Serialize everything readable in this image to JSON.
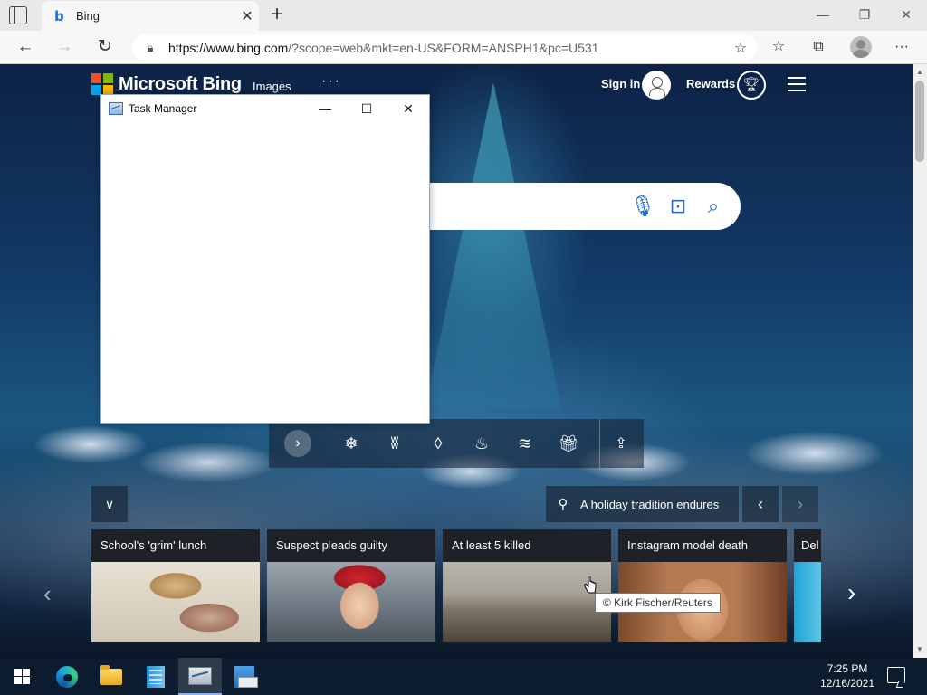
{
  "browser": {
    "tab_title": "Bing",
    "tab_favicon": "b",
    "url_host": "https://www.bing.com",
    "url_path": "/?scope=web&mkt=en-US&FORM=ANSPH1&pc=U531"
  },
  "bing": {
    "logo_text": "Microsoft Bing",
    "nav_images": "Images",
    "nav_more": "···",
    "signin": "Sign in",
    "rewards": "Rewards",
    "caption": "A holiday tradition endures",
    "image_credit": "© Kirk Fischer/Reuters",
    "news_cards": [
      {
        "title": "School's 'grim' lunch",
        "image": "pie-image"
      },
      {
        "title": "Suspect pleads guilty",
        "image": "person-image"
      },
      {
        "title": "At least 5 killed",
        "image": "storm-image"
      },
      {
        "title": "Instagram model death",
        "image": "face-image"
      },
      {
        "title": "Del",
        "image": "partial-image"
      }
    ]
  },
  "task_manager": {
    "title": "Task Manager"
  },
  "taskbar": {
    "time": "7:25 PM",
    "date": "12/16/2021"
  },
  "icons": {
    "search_bar_icons": [
      "microphone-icon",
      "visual-search-icon",
      "search-icon"
    ],
    "theme_icons": [
      "snowflake-icon",
      "icicles-icon",
      "ornament-icon",
      "fire-icon",
      "ribbon-icon",
      "gift-icon"
    ]
  },
  "colors": {
    "bing_accent": "#1a6ad3",
    "taskbar_bg": "#0c1b2e"
  }
}
